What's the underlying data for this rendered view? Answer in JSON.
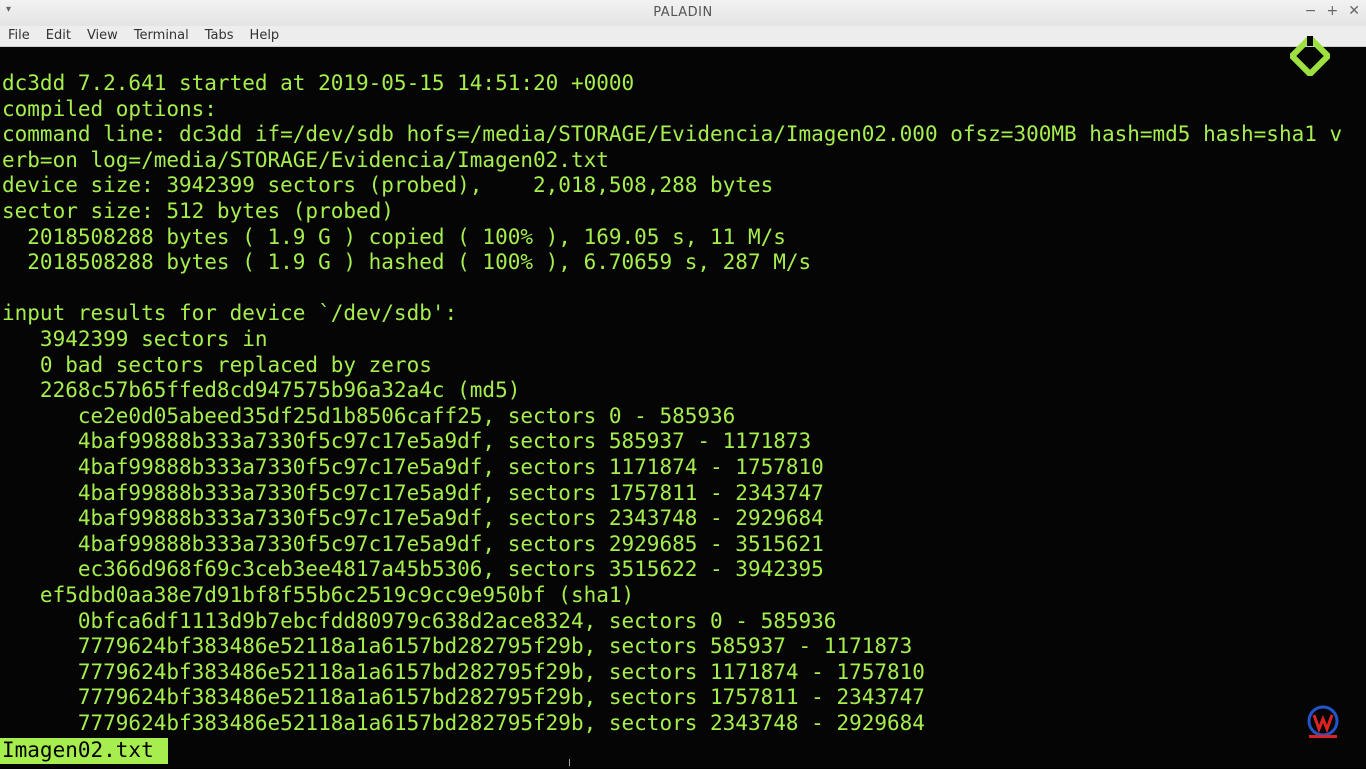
{
  "window": {
    "title": "PALADIN",
    "menu_arrow": "▾",
    "min": "−",
    "max": "+",
    "close": "✕"
  },
  "menu": [
    "File",
    "Edit",
    "View",
    "Terminal",
    "Tabs",
    "Help"
  ],
  "terminal": {
    "lines": [
      "dc3dd 7.2.641 started at 2019-05-15 14:51:20 +0000",
      "compiled options:",
      "command line: dc3dd if=/dev/sdb hofs=/media/STORAGE/Evidencia/Imagen02.000 ofsz=300MB hash=md5 hash=sha1 v",
      "erb=on log=/media/STORAGE/Evidencia/Imagen02.txt",
      "device size: 3942399 sectors (probed),    2,018,508,288 bytes",
      "sector size: 512 bytes (probed)",
      "  2018508288 bytes ( 1.9 G ) copied ( 100% ), 169.05 s, 11 M/s",
      "  2018508288 bytes ( 1.9 G ) hashed ( 100% ), 6.70659 s, 287 M/s",
      "",
      "input results for device `/dev/sdb':",
      "   3942399 sectors in",
      "   0 bad sectors replaced by zeros",
      "   2268c57b65ffed8cd947575b96a32a4c (md5)",
      "      ce2e0d05abeed35df25d1b8506caff25, sectors 0 - 585936",
      "      4baf99888b333a7330f5c97c17e5a9df, sectors 585937 - 1171873",
      "      4baf99888b333a7330f5c97c17e5a9df, sectors 1171874 - 1757810",
      "      4baf99888b333a7330f5c97c17e5a9df, sectors 1757811 - 2343747",
      "      4baf99888b333a7330f5c97c17e5a9df, sectors 2343748 - 2929684",
      "      4baf99888b333a7330f5c97c17e5a9df, sectors 2929685 - 3515621",
      "      ec366d968f69c3ceb3ee4817a45b5306, sectors 3515622 - 3942395",
      "   ef5dbd0aa38e7d91bf8f55b6c2519c9cc9e950bf (sha1)",
      "      0bfca6df1113d9b7ebcfdd80979c638d2ace8324, sectors 0 - 585936",
      "      7779624bf383486e52118a1a6157bd282795f29b, sectors 585937 - 1171873",
      "      7779624bf383486e52118a1a6157bd282795f29b, sectors 1171874 - 1757810",
      "      7779624bf383486e52118a1a6157bd282795f29b, sectors 1757811 - 2343747",
      "      7779624bf383486e52118a1a6157bd282795f29b, sectors 2343748 - 2929684"
    ],
    "status_file": "Imagen02.txt",
    "text_color": "#a5ee4e",
    "background": "#050505"
  },
  "icons": {
    "logo": "paladin-logo-icon",
    "watermark": "channel-watermark-icon",
    "mouse": "mouse-pointer-icon"
  }
}
